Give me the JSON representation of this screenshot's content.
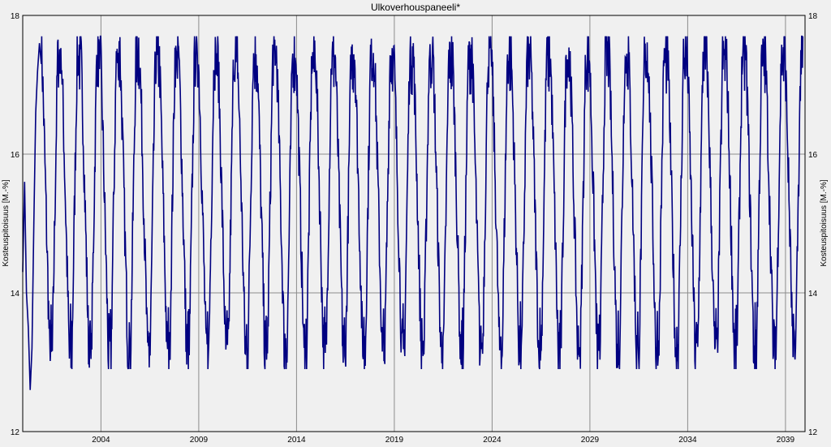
{
  "chart_data": {
    "type": "line",
    "title": "Ulkoverhouspaneeli*",
    "ylabel_left": "Kosteuspitoisuus [M.-%]",
    "ylabel_right": "Kosteuspitoisuus [M.-%]",
    "xlabel": "",
    "xlim": [
      "2000-01-01",
      "2039-12-31"
    ],
    "ylim": [
      12,
      18
    ],
    "y_ticks": [
      12,
      14,
      16,
      18
    ],
    "x_ticks": [
      "2004",
      "2009",
      "2014",
      "2019",
      "2024",
      "2029",
      "2034",
      "2039"
    ],
    "grid": true,
    "legend": "none",
    "colors": {
      "line": "#000080",
      "background": "#f0f0f0",
      "grid": "#8c8c8c",
      "axis": "#000000"
    },
    "series": [
      {
        "points_note": "seasonal cycle, one point per quarter-month approx; values in M.-%",
        "x_start_year": 2000.0,
        "x_end_year": 2039.9,
        "first_year_values": [
          14.3,
          15.6,
          14.0,
          13.5,
          12.6,
          13.2,
          15.0,
          16.6,
          17.2,
          17.6
        ],
        "cycle_min": 12.9,
        "cycle_max": 17.7,
        "cycle_period_years": 1.0
      }
    ]
  }
}
